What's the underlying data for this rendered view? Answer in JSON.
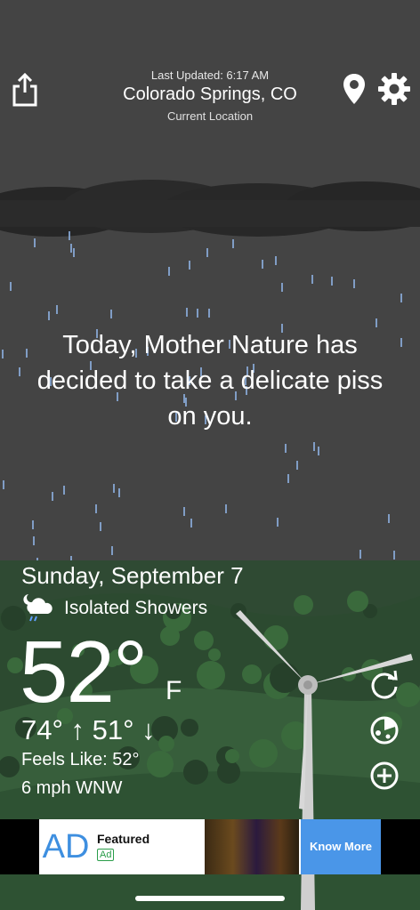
{
  "header": {
    "last_updated": "Last Updated: 6:17 AM",
    "city": "Colorado Springs, CO",
    "location_label": "Current Location"
  },
  "icons": {
    "share": "share-icon",
    "location": "location-pin-icon",
    "settings": "gear-icon",
    "condition": "night-cloud-rain-icon",
    "refresh": "refresh-icon",
    "radar": "radar-icon",
    "add": "plus-circle-icon"
  },
  "message": "Today, Mother Nature has decided to take a delicate piss on you.",
  "weather": {
    "date": "Sunday, September 7",
    "condition": "Isolated Showers",
    "temperature": "52°",
    "unit": "F",
    "hi_lo": "74° ↑ 51° ↓",
    "feels_like": "Feels Like: 52°",
    "wind": "6 mph WNW"
  },
  "ad": {
    "logo_text": "AD",
    "title": "Featured",
    "tag": "Ad",
    "cta": "Know More"
  },
  "colors": {
    "sky": "#444444",
    "cloud": "#2a2a2a",
    "rain": "#8fb4e6",
    "grass": "#2f4a33",
    "ad_accent": "#4a96e8"
  }
}
